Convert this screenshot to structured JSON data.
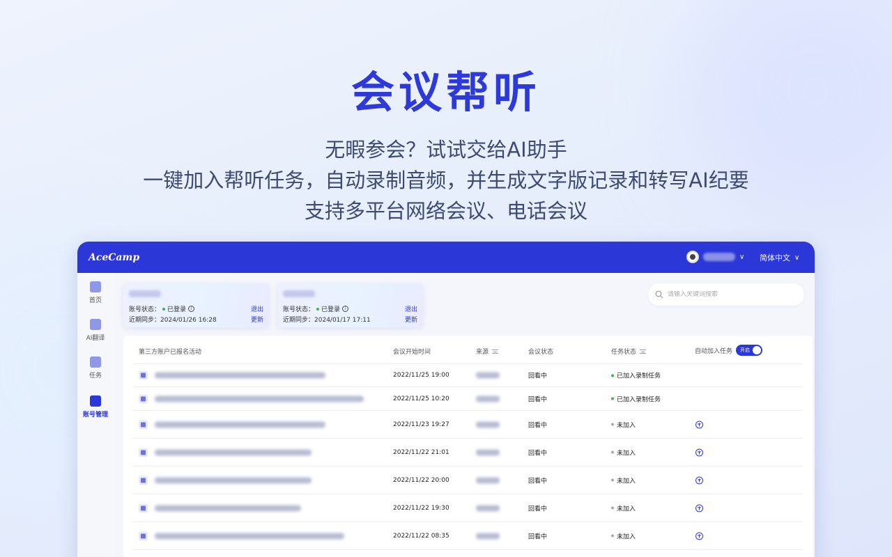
{
  "hero": {
    "title": "会议帮听",
    "line1": "无暇参会？试试交给AI助手",
    "line2": "一键加入帮听任务，自动录制音频，并生成文字版记录和转写AI纪要",
    "line3": "支持多平台网络会议、电话会议"
  },
  "topbar": {
    "logo": "AceCamp",
    "language": "简体中文",
    "caret": "∨"
  },
  "sidebar": {
    "items": [
      {
        "label": "首页",
        "icon": "home-icon"
      },
      {
        "label": "AI翻译",
        "icon": "ai-translate-icon"
      },
      {
        "label": "任务",
        "icon": "task-icon"
      },
      {
        "label": "账号管理",
        "icon": "account-management-icon"
      }
    ]
  },
  "accounts": [
    {
      "status_label": "账号状态：",
      "status": "已登录",
      "logout": "退出",
      "sync_label": "近期同步：",
      "sync_time": "2024/01/26 16:28",
      "update": "更新"
    },
    {
      "status_label": "账号状态：",
      "status": "已登录",
      "logout": "退出",
      "sync_label": "近期同步：",
      "sync_time": "2024/01/17 17:11",
      "update": "更新"
    }
  ],
  "search": {
    "placeholder": "请输入关键词搜索"
  },
  "table": {
    "headers": {
      "event": "第三方账户已报名活动",
      "start_time": "会议开始时间",
      "source": "来源",
      "meeting_status": "会议状态",
      "task_status": "任务状态",
      "auto_join": "自动加入任务",
      "toggle": "开启"
    },
    "rows": [
      {
        "time": "2022/11/25 19:00",
        "meeting_status": "回看中",
        "task_status": "已加入录制任务",
        "joined": true
      },
      {
        "time": "2022/11/25 10:20",
        "meeting_status": "回看中",
        "task_status": "已加入录制任务",
        "joined": true
      },
      {
        "time": "2022/11/23 19:27",
        "meeting_status": "回看中",
        "task_status": "未加入",
        "joined": false
      },
      {
        "time": "2022/11/22 21:01",
        "meeting_status": "回看中",
        "task_status": "未加入",
        "joined": false
      },
      {
        "time": "2022/11/22 20:00",
        "meeting_status": "回看中",
        "task_status": "未加入",
        "joined": false
      },
      {
        "time": "2022/11/22 19:30",
        "meeting_status": "回看中",
        "task_status": "未加入",
        "joined": false
      },
      {
        "time": "2022/11/22 08:35",
        "meeting_status": "回看中",
        "task_status": "未加入",
        "joined": false
      }
    ]
  },
  "colors": {
    "accent": "#2b37d6",
    "hero_title": "#2d39d9",
    "joined_dot": "#3ab54a"
  }
}
